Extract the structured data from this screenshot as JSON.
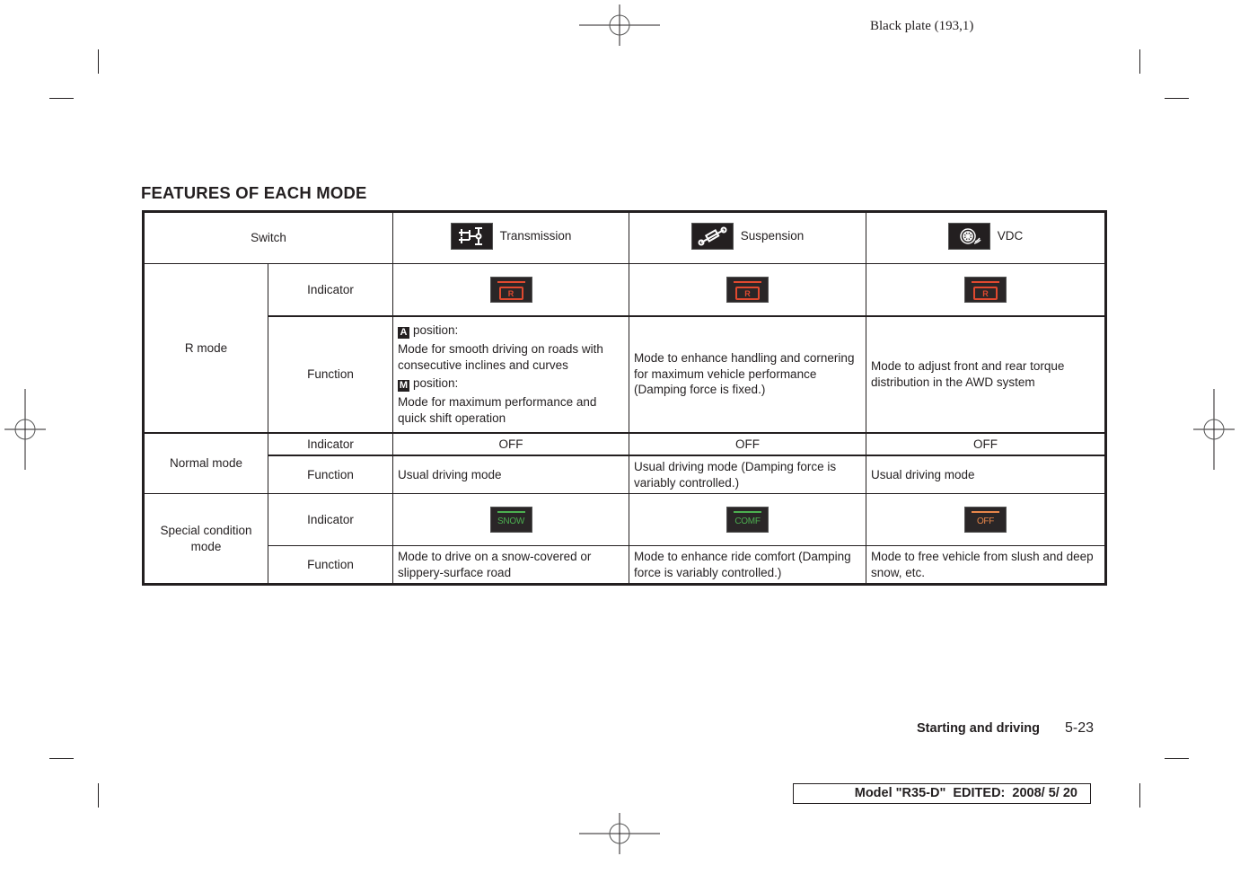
{
  "plate": "Black plate (193,1)",
  "section_title": "FEATURES OF EACH MODE",
  "table": {
    "switch_header": "Switch",
    "columns": [
      {
        "label": "Transmission",
        "icon": "transmission-icon"
      },
      {
        "label": "Suspension",
        "icon": "suspension-icon"
      },
      {
        "label": "VDC",
        "icon": "vdc-tire-icon"
      }
    ],
    "row_labels": {
      "indicator": "Indicator",
      "function": "Function"
    },
    "modes": {
      "r_mode": {
        "label": "R mode",
        "indicators": [
          {
            "text": "R",
            "color": "#e0492f"
          },
          {
            "text": "R",
            "color": "#e0492f"
          },
          {
            "text": "R",
            "color": "#e0492f"
          }
        ],
        "transmission_function": {
          "a_badge": "A",
          "a_heading": "position:",
          "a_text": "Mode for smooth driving on roads with consecutive inclines and curves",
          "m_badge": "M",
          "m_heading": "position:",
          "m_text": "Mode for maximum performance and quick shift operation"
        },
        "suspension_function": "Mode to enhance handling and cornering for maximum vehicle performance (Damping force is fixed.)",
        "vdc_function": "Mode to adjust front and rear torque distribution in the AWD system"
      },
      "normal_mode": {
        "label": "Normal mode",
        "indicators": [
          "OFF",
          "OFF",
          "OFF"
        ],
        "functions": [
          "Usual driving mode",
          "Usual driving mode (Damping force is variably controlled.)",
          "Usual driving mode"
        ]
      },
      "special_mode": {
        "label": "Special condition mode",
        "indicators": [
          {
            "text": "SNOW",
            "color": "#4caf50"
          },
          {
            "text": "COMF",
            "color": "#4caf50"
          },
          {
            "text": "OFF",
            "color": "#e8864a"
          }
        ],
        "functions": [
          "Mode to drive on a snow-covered or slippery-surface road",
          "Mode to enhance ride comfort (Damping force is variably controlled.)",
          "Mode to free vehicle from slush and deep snow, etc."
        ]
      }
    }
  },
  "footer": {
    "section": "Starting and driving",
    "page": "5-23",
    "model_line": "Model \"R35-D\"  EDITED:  2008/ 5/ 20"
  }
}
